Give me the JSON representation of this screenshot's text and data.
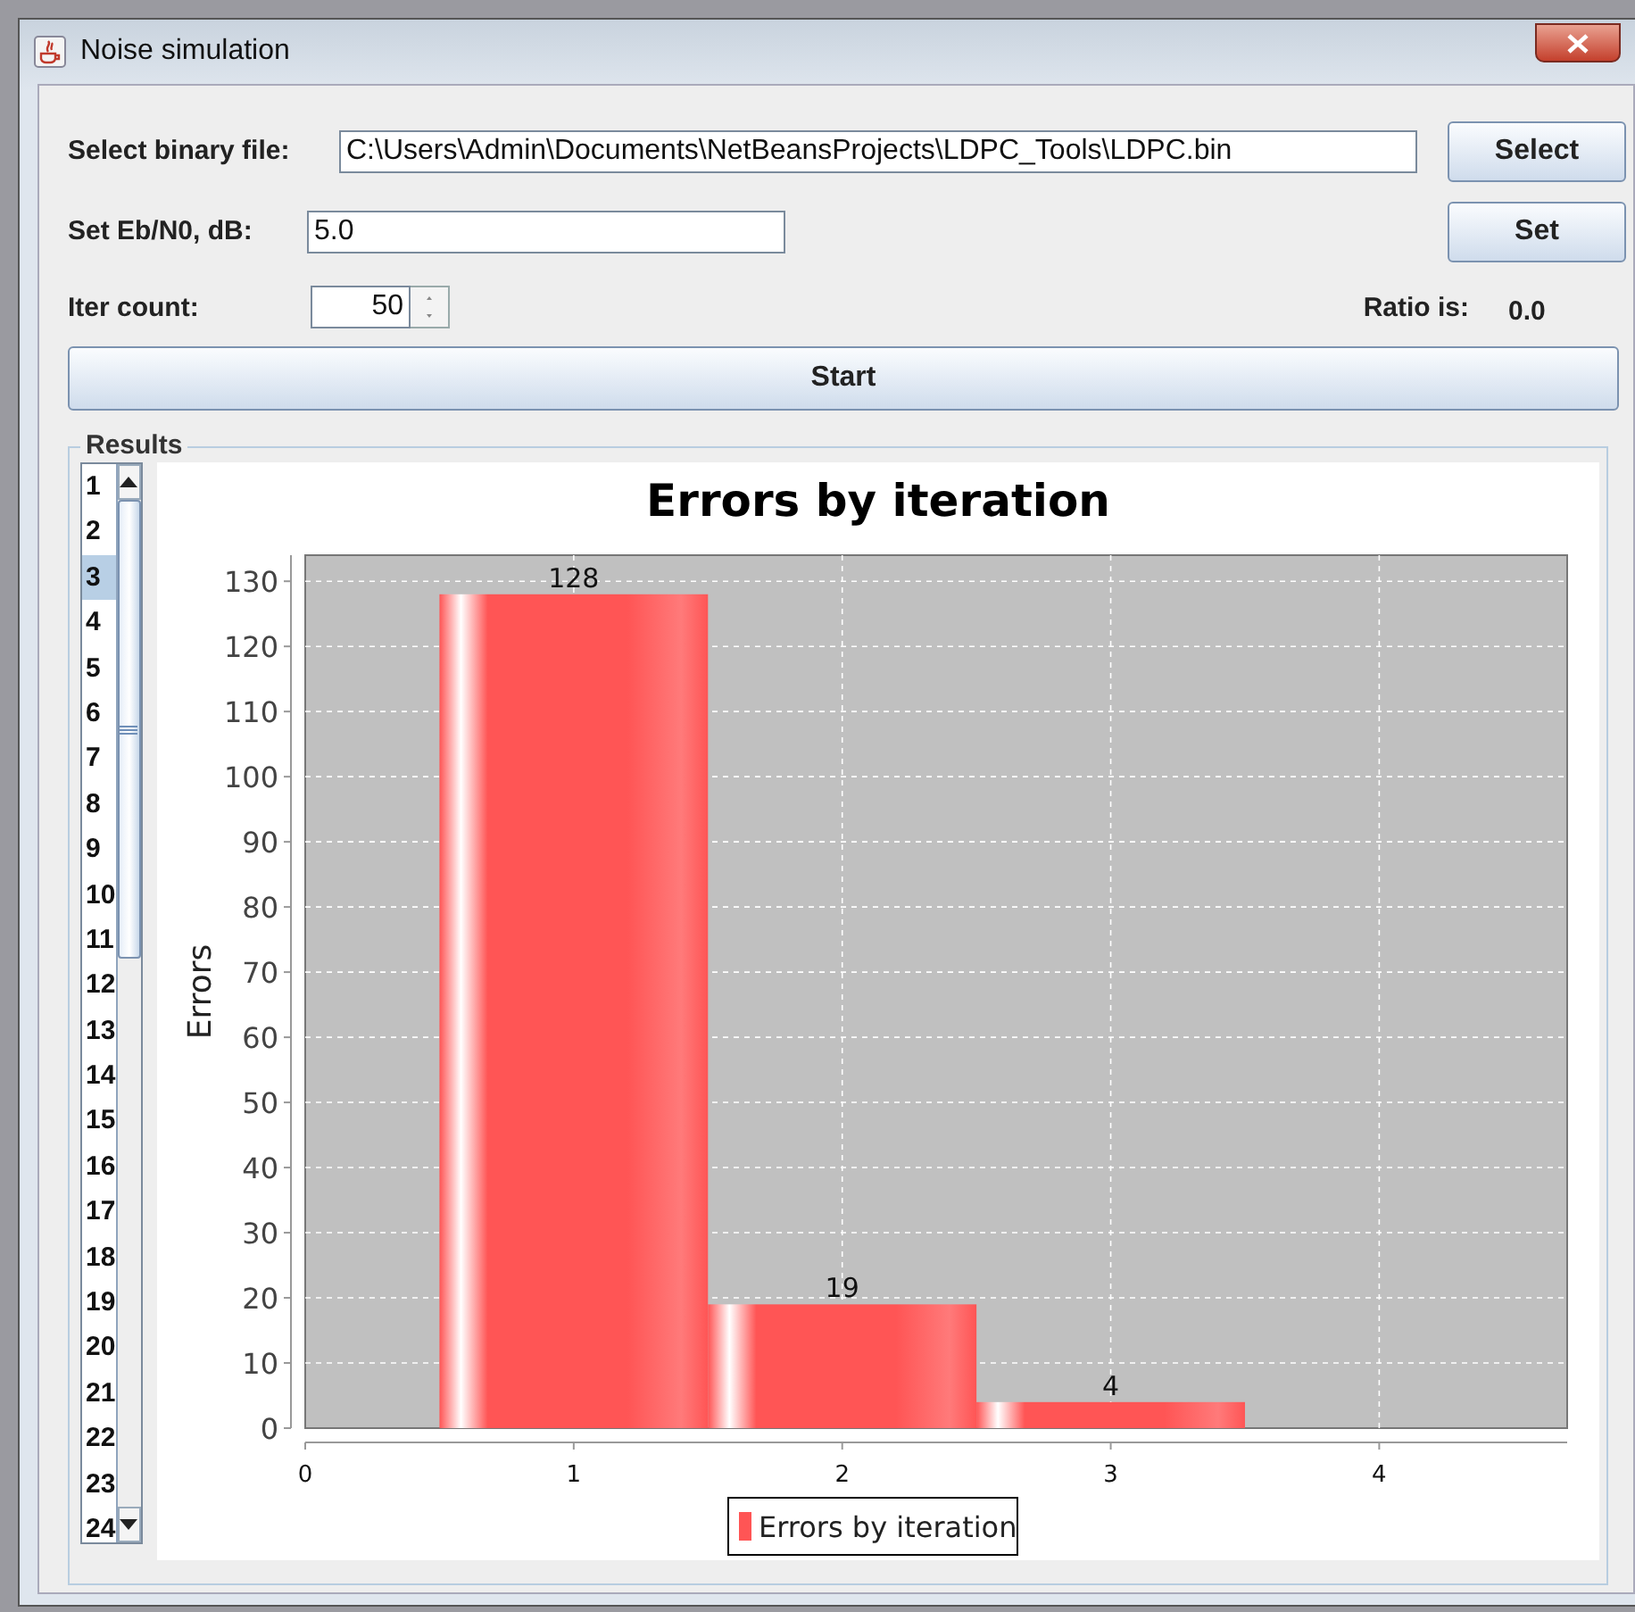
{
  "window": {
    "title": "Noise simulation"
  },
  "file": {
    "label": "Select binary file:",
    "value": "C:\\Users\\Admin\\Documents\\NetBeansProjects\\LDPC_Tools\\LDPC.bin",
    "button": "Select"
  },
  "ebn0": {
    "label": "Set Eb/N0, dB:",
    "value": "5.0",
    "button": "Set"
  },
  "iter": {
    "label": "Iter count:",
    "value": "50"
  },
  "ratio": {
    "label": "Ratio is:",
    "value": "0.0"
  },
  "start_button": "Start",
  "results": {
    "title": "Results",
    "items": [
      {
        "label": "1",
        "selected": false
      },
      {
        "label": "2",
        "selected": false
      },
      {
        "label": "3",
        "selected": true
      },
      {
        "label": "4",
        "selected": false
      },
      {
        "label": "5",
        "selected": false
      },
      {
        "label": "6",
        "selected": false
      },
      {
        "label": "7",
        "selected": false
      },
      {
        "label": "8",
        "selected": false
      },
      {
        "label": "9",
        "selected": false
      },
      {
        "label": "10",
        "selected": false
      },
      {
        "label": "11",
        "selected": false
      },
      {
        "label": "12",
        "selected": false
      },
      {
        "label": "13",
        "selected": false
      },
      {
        "label": "14",
        "selected": false
      },
      {
        "label": "15",
        "selected": false
      },
      {
        "label": "16",
        "selected": false
      },
      {
        "label": "17",
        "selected": false
      },
      {
        "label": "18",
        "selected": false
      },
      {
        "label": "19",
        "selected": false
      },
      {
        "label": "20",
        "selected": false
      },
      {
        "label": "21",
        "selected": false
      },
      {
        "label": "22",
        "selected": false
      },
      {
        "label": "23",
        "selected": false
      },
      {
        "label": "24",
        "selected": false
      }
    ],
    "chart_data": {
      "type": "bar",
      "title": "Errors by iteration",
      "ylabel": "Errors",
      "x": [
        1,
        2,
        3
      ],
      "series": [
        {
          "name": "Errors by iteration",
          "color": "#ff5555",
          "values": [
            128,
            19,
            4
          ]
        }
      ],
      "xlim": [
        0,
        4.7
      ],
      "ylim": [
        0,
        134
      ],
      "xticks": [
        0,
        1,
        2,
        3,
        4
      ],
      "yticks": [
        0,
        10,
        20,
        30,
        40,
        50,
        60,
        70,
        80,
        90,
        100,
        110,
        120,
        130
      ],
      "data_labels": true,
      "grid": true
    }
  }
}
